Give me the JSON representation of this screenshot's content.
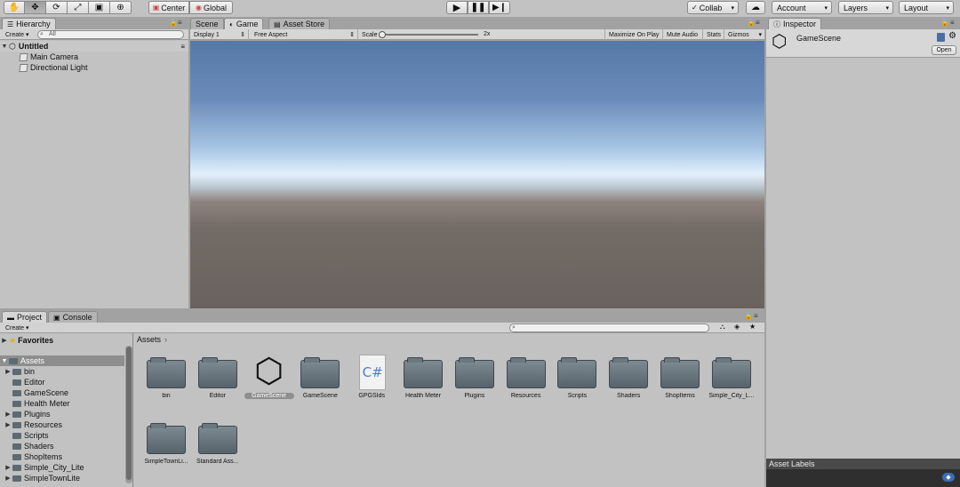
{
  "toolbar": {
    "tools": [
      "hand-icon",
      "move-icon",
      "rotate-icon",
      "scale-icon",
      "rect-icon",
      "transform-icon"
    ],
    "pivot_mode": "Center",
    "pivot_rotation": "Global",
    "collab": "Collab",
    "account": "Account",
    "layers": "Layers",
    "layout": "Layout"
  },
  "hierarchy": {
    "tab": "Hierarchy",
    "create": "Create",
    "search_placeholder": "All",
    "scene": "Untitled",
    "items": [
      "Main Camera",
      "Directional Light"
    ]
  },
  "center_tabs": [
    "Scene",
    "Game",
    "Asset Store"
  ],
  "game": {
    "display": "Display 1",
    "aspect": "Free Aspect",
    "scale_label": "Scale",
    "scale_value": "2x",
    "maximize": "Maximize On Play",
    "mute": "Mute Audio",
    "stats": "Stats",
    "gizmos": "Gizmos"
  },
  "inspector": {
    "tab": "Inspector",
    "object": "GameScene",
    "open_button": "Open",
    "asset_labels": "Asset Labels"
  },
  "project": {
    "tabs": [
      "Project",
      "Console"
    ],
    "create": "Create",
    "favorites": "Favorites",
    "assets_root": "Assets",
    "breadcrumb": "Assets",
    "tree": [
      {
        "label": "bin",
        "expandable": true
      },
      {
        "label": "Editor",
        "expandable": false
      },
      {
        "label": "GameScene",
        "expandable": false
      },
      {
        "label": "Health Meter",
        "expandable": false
      },
      {
        "label": "Plugins",
        "expandable": true
      },
      {
        "label": "Resources",
        "expandable": true
      },
      {
        "label": "Scripts",
        "expandable": false
      },
      {
        "label": "Shaders",
        "expandable": false
      },
      {
        "label": "ShopItems",
        "expandable": false
      },
      {
        "label": "Simple_City_Lite",
        "expandable": true
      },
      {
        "label": "SimpleTownLite",
        "expandable": true
      }
    ],
    "assets": [
      {
        "label": "bin",
        "kind": "folder"
      },
      {
        "label": "Editor",
        "kind": "folder"
      },
      {
        "label": "GameScene",
        "kind": "scene"
      },
      {
        "label": "GameScene",
        "kind": "folder"
      },
      {
        "label": "GPGSIds",
        "kind": "script"
      },
      {
        "label": "Health Meter",
        "kind": "folder"
      },
      {
        "label": "Plugins",
        "kind": "folder"
      },
      {
        "label": "Resources",
        "kind": "folder"
      },
      {
        "label": "Scripts",
        "kind": "folder"
      },
      {
        "label": "Shaders",
        "kind": "folder"
      },
      {
        "label": "ShopItems",
        "kind": "folder"
      },
      {
        "label": "Simple_City_L...",
        "kind": "folder"
      },
      {
        "label": "SimpleTownLi...",
        "kind": "folder"
      },
      {
        "label": "Standard Ass...",
        "kind": "folder"
      }
    ],
    "script_glyph": "C#"
  }
}
